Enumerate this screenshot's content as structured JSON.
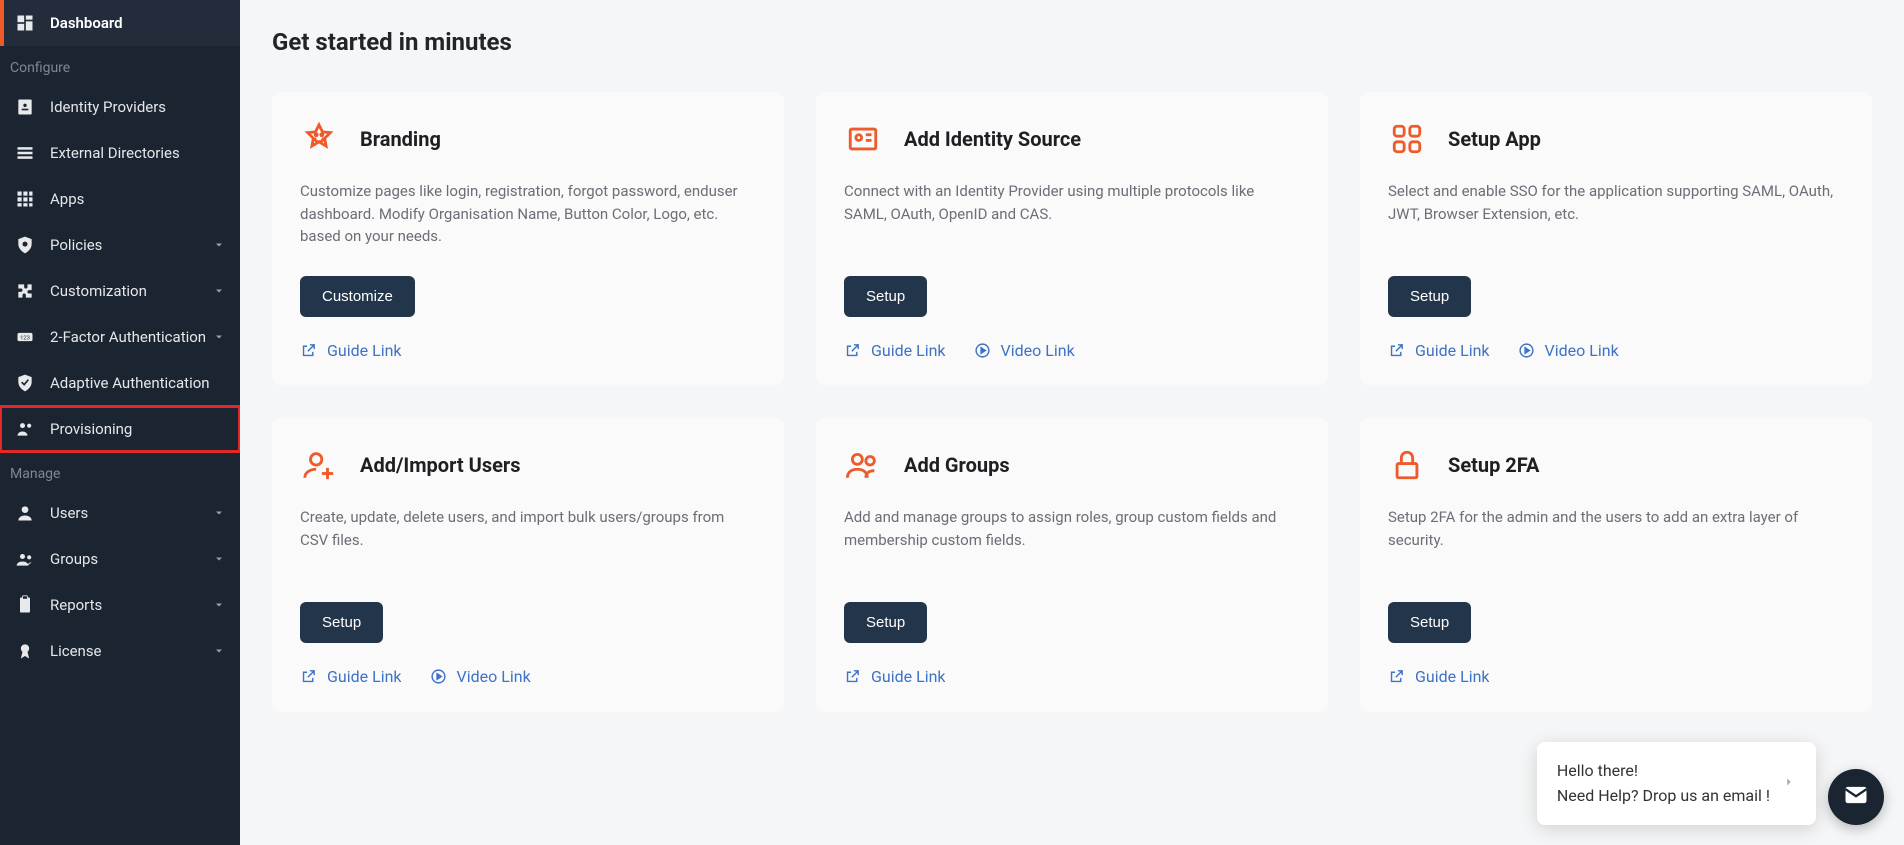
{
  "sidebar": {
    "items": [
      {
        "label": "Dashboard"
      },
      {
        "label": "Identity Providers"
      },
      {
        "label": "External Directories"
      },
      {
        "label": "Apps"
      },
      {
        "label": "Policies"
      },
      {
        "label": "Customization"
      },
      {
        "label": "2-Factor Authentication"
      },
      {
        "label": "Adaptive Authentication"
      },
      {
        "label": "Provisioning"
      },
      {
        "label": "Users"
      },
      {
        "label": "Groups"
      },
      {
        "label": "Reports"
      },
      {
        "label": "License"
      }
    ],
    "sections": {
      "configure": "Configure",
      "manage": "Manage"
    }
  },
  "page": {
    "title": "Get started in minutes"
  },
  "cards": [
    {
      "title": "Branding",
      "desc": "Customize pages like login, registration, forgot password, enduser dashboard. Modify Organisation Name, Button Color, Logo, etc. based on your needs.",
      "button": "Customize",
      "links": {
        "guide": "Guide Link"
      }
    },
    {
      "title": "Add Identity Source",
      "desc": "Connect with an Identity Provider using multiple protocols like SAML, OAuth, OpenID and CAS.",
      "button": "Setup",
      "links": {
        "guide": "Guide Link",
        "video": "Video Link"
      }
    },
    {
      "title": "Setup App",
      "desc": "Select and enable SSO for the application supporting SAML, OAuth, JWT, Browser Extension, etc.",
      "button": "Setup",
      "links": {
        "guide": "Guide Link",
        "video": "Video Link"
      }
    },
    {
      "title": "Add/Import Users",
      "desc": "Create, update, delete users, and import bulk users/groups from CSV files.",
      "button": "Setup",
      "links": {
        "guide": "Guide Link",
        "video": "Video Link"
      }
    },
    {
      "title": "Add Groups",
      "desc": "Add and manage groups to assign roles, group custom fields and membership custom fields.",
      "button": "Setup",
      "links": {
        "guide": "Guide Link"
      }
    },
    {
      "title": "Setup 2FA",
      "desc": "Setup 2FA for the admin and the users to add an extra layer of security.",
      "button": "Setup",
      "links": {
        "guide": "Guide Link"
      }
    }
  ],
  "chat": {
    "line1": "Hello there!",
    "line2": "Need Help? Drop us an email !"
  }
}
